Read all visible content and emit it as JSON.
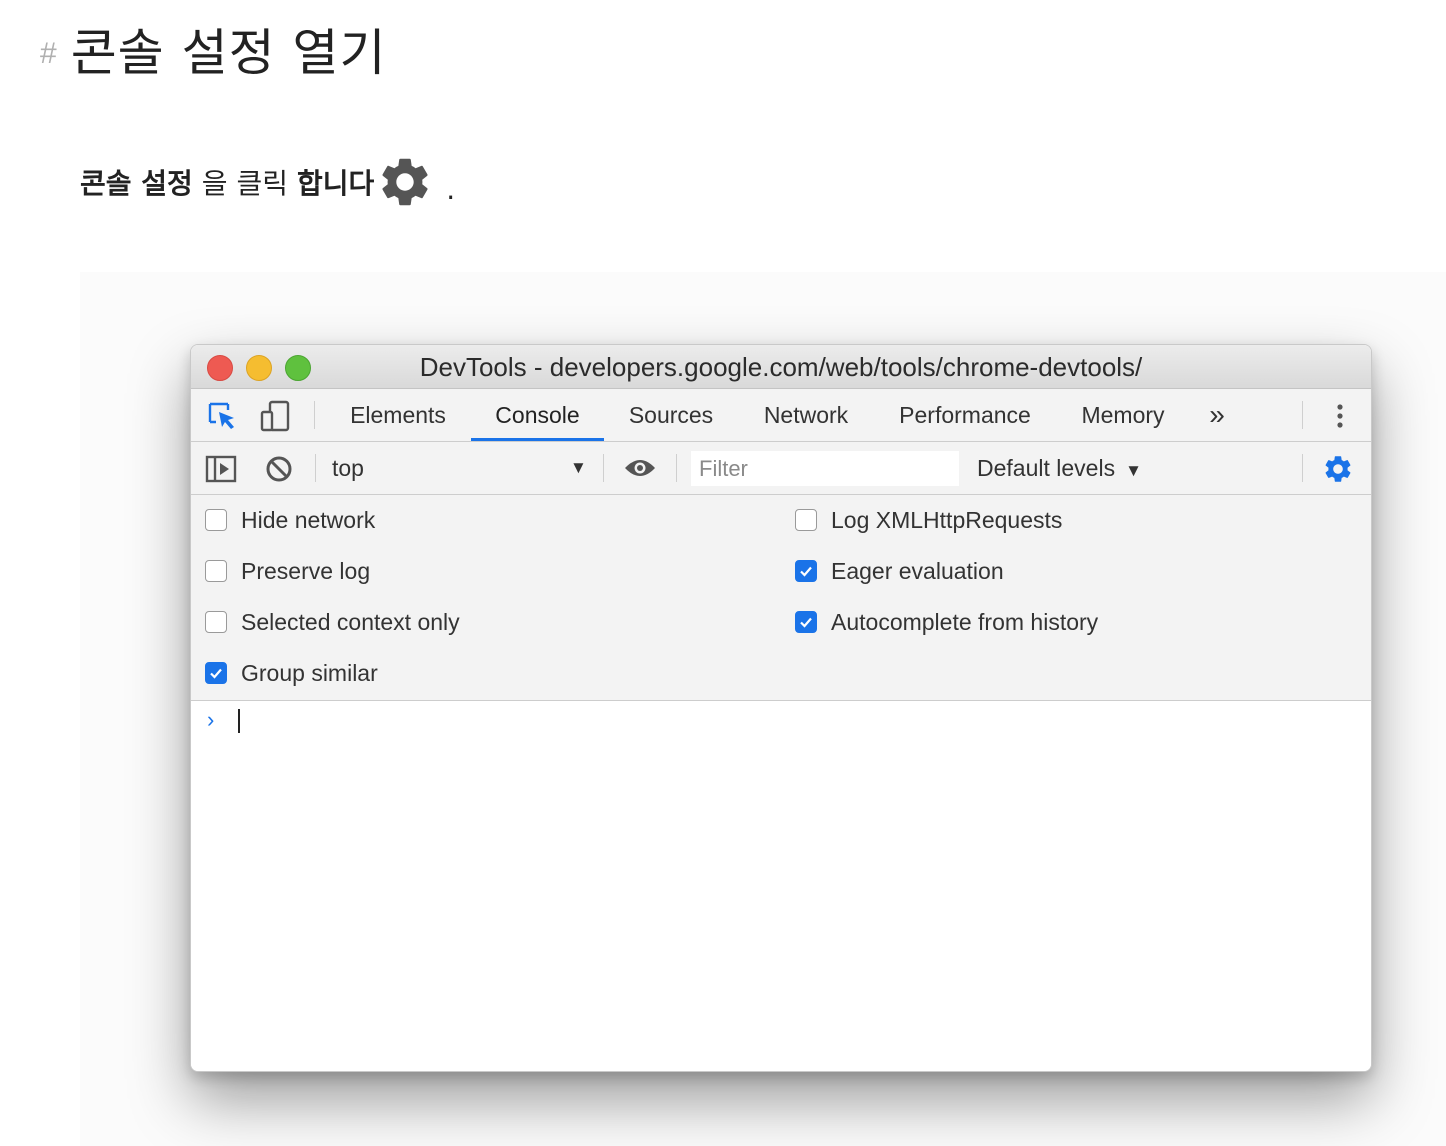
{
  "heading": {
    "hash": "#",
    "title": "콘솔 설정 열기"
  },
  "instruction": {
    "part1": "콘솔 설정",
    "part2": "을 클릭",
    "part3": "합니다",
    "gear_icon": "gear-icon",
    "end": "."
  },
  "window": {
    "title": "DevTools - developers.google.com/web/tools/chrome-devtools/",
    "traffic_lights": [
      "close",
      "minimize",
      "zoom"
    ]
  },
  "tabs": {
    "items": [
      "Elements",
      "Console",
      "Sources",
      "Network",
      "Performance",
      "Memory"
    ],
    "active": "Console",
    "more": "»",
    "icons": [
      "inspect-element-icon",
      "device-toolbar-icon",
      "more-tabs-icon",
      "kebab-menu-icon"
    ]
  },
  "toolbar": {
    "context": "top",
    "context_arrow": "▼",
    "filter_placeholder": "Filter",
    "levels": "Default levels",
    "levels_arrow": "▼",
    "icons": [
      "sidebar-toggle-icon",
      "clear-console-icon",
      "eye-icon",
      "gear-icon"
    ]
  },
  "settings": {
    "left": [
      {
        "label": "Hide network",
        "checked": false
      },
      {
        "label": "Preserve log",
        "checked": false
      },
      {
        "label": "Selected context only",
        "checked": false
      },
      {
        "label": "Group similar",
        "checked": true
      }
    ],
    "right": [
      {
        "label": "Log XMLHttpRequests",
        "checked": false
      },
      {
        "label": "Eager evaluation",
        "checked": true
      },
      {
        "label": "Autocomplete from history",
        "checked": true
      }
    ]
  },
  "console": {
    "prompt": "›"
  },
  "colors": {
    "accent": "#1a73e8",
    "close": "#ee5a52",
    "minimize": "#f5bd30",
    "zoom": "#5fc13e"
  }
}
